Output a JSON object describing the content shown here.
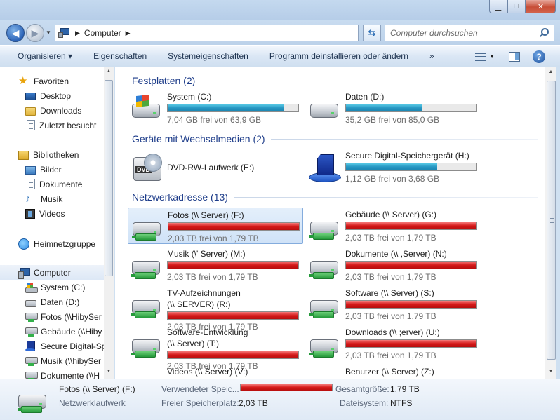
{
  "window": {
    "controls": {
      "minimize": "▁",
      "maximize": "□",
      "close": "✕"
    }
  },
  "address": {
    "path": "Computer",
    "separator": "▶"
  },
  "search": {
    "placeholder": "Computer durchsuchen",
    "icon": "search-icon"
  },
  "toolbar": {
    "items": [
      {
        "label": "Organisieren ▾"
      },
      {
        "label": "Eigenschaften"
      },
      {
        "label": "Systemeigenschaften"
      },
      {
        "label": "Programm deinstallieren oder ändern"
      },
      {
        "label": "»"
      }
    ],
    "help": "?"
  },
  "sidebar": {
    "items": [
      {
        "label": "Favoriten",
        "icon": "star-icon"
      },
      {
        "label": "Desktop",
        "icon": "desktop-icon"
      },
      {
        "label": "Downloads",
        "icon": "downloads-folder-icon"
      },
      {
        "label": "Zuletzt besucht",
        "icon": "recent-places-icon"
      },
      {
        "label": "Bibliotheken",
        "icon": "libraries-icon"
      },
      {
        "label": "Bilder",
        "icon": "pictures-icon"
      },
      {
        "label": "Dokumente",
        "icon": "documents-icon"
      },
      {
        "label": "Musik",
        "icon": "music-icon"
      },
      {
        "label": "Videos",
        "icon": "videos-icon"
      },
      {
        "label": "Heimnetzgruppe",
        "icon": "homegroup-icon"
      },
      {
        "label": "Computer",
        "icon": "computer-icon"
      },
      {
        "label": "System (C:)",
        "icon": "system-drive-icon"
      },
      {
        "label": "Daten (D:)",
        "icon": "hard-drive-icon"
      },
      {
        "label": "Fotos (\\\\HibySer",
        "icon": "network-drive-icon"
      },
      {
        "label": "Gebäude (\\\\Hiby",
        "icon": "network-drive-icon"
      },
      {
        "label": "Secure Digital-Sp",
        "icon": "sd-card-icon"
      },
      {
        "label": "Musik (\\\\hibySer",
        "icon": "network-drive-icon"
      },
      {
        "label": "Dokumente (\\\\H",
        "icon": "network-drive-icon"
      }
    ]
  },
  "groups": {
    "hdd": {
      "title": "Festplatten (2)"
    },
    "removable": {
      "title": "Geräte mit Wechselmedien (2)"
    },
    "network": {
      "title": "Netzwerkadresse (13)"
    }
  },
  "drives": {
    "system": {
      "name": "System (C:)",
      "sub": "7,04 GB frei von 63,9 GB",
      "used_pct": 89
    },
    "daten": {
      "name": "Daten (D:)",
      "sub": "35,2 GB frei von 85,0 GB",
      "used_pct": 58
    },
    "dvd": {
      "name": "DVD-RW-Laufwerk (E:)",
      "badge": "DVD"
    },
    "sd": {
      "name": "Secure Digital-Speichergerät (H:)",
      "sub": "1,12 GB frei von 3,68 GB",
      "used_pct": 70
    },
    "fotos": {
      "name": "Fotos (\\\\        Server) (F:)",
      "sub": "2,03 TB frei von 1,79 TB",
      "used_pct": 100
    },
    "gebaeude": {
      "name": "Gebäude (\\\\        Server) (G:)",
      "sub": "2,03 TB frei von 1,79 TB",
      "used_pct": 100
    },
    "musik": {
      "name": "Musik (\\'          Server) (M:)",
      "sub": "2,03 TB frei von 1,79 TB",
      "used_pct": 100
    },
    "dokumente": {
      "name": "Dokumente (\\\\      ,Server) (N:)",
      "sub": "2,03 TB frei von 1,79 TB",
      "used_pct": 100
    },
    "tv": {
      "name": "TV-Aufzeichnungen",
      "name2": "(\\\\        SERVER) (R:)",
      "sub": "2,03 TB frei von 1,79 TB",
      "used_pct": 100
    },
    "software": {
      "name": "Software (\\\\          Server) (S:)",
      "sub": "2,03 TB frei von 1,79 TB",
      "used_pct": 100
    },
    "swentw": {
      "name": "Software-Entwicklung",
      "name2": "(\\\\        Server) (T:)",
      "sub": "2,03 TB frei von 1,79 TB",
      "used_pct": 100
    },
    "downloads": {
      "name": "Downloads (\\\\         ;erver) (U:)",
      "sub": "2,03 TB frei von 1,79 TB",
      "used_pct": 100
    },
    "videos": {
      "name": "Videos (\\\\          Server) (V:)"
    },
    "benutzer": {
      "name": "Benutzer (\\\\          Server) (Z:)"
    }
  },
  "details": {
    "name": "Fotos (\\\\        Server) (F:)",
    "type": "Netzwerklaufwerk",
    "used_label": "Verwendeter Speic...",
    "used_pct": 100,
    "free_label": "Freier Speicherplatz:",
    "free_value": "2,03 TB",
    "total_label": "Gesamtgröße:",
    "total_value": "1,79 TB",
    "fs_label": "Dateisystem:",
    "fs_value": "NTFS"
  },
  "colors": {
    "bar_normal": "#2696c2",
    "bar_full": "#d51a1a",
    "group_title": "#1e3d8a",
    "selection": "#cfe2f7"
  }
}
